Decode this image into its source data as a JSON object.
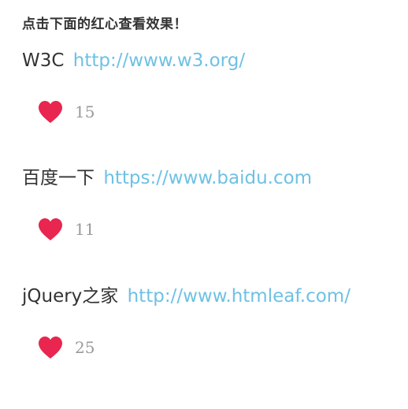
{
  "hint": "点击下面的红心查看效果！",
  "entries": [
    {
      "name": "W3C",
      "url": "http://www.w3.org/",
      "likes": "15"
    },
    {
      "name": "百度一下",
      "url": "https://www.baidu.com",
      "likes": "11"
    },
    {
      "name": "jQuery之家",
      "url": "http://www.htmleaf.com/",
      "likes": "25"
    }
  ],
  "colors": {
    "heart": "#e8264f",
    "link": "#6ec1e4",
    "count": "#999999",
    "text": "#333333"
  },
  "icons": {
    "like": "heart-icon"
  }
}
